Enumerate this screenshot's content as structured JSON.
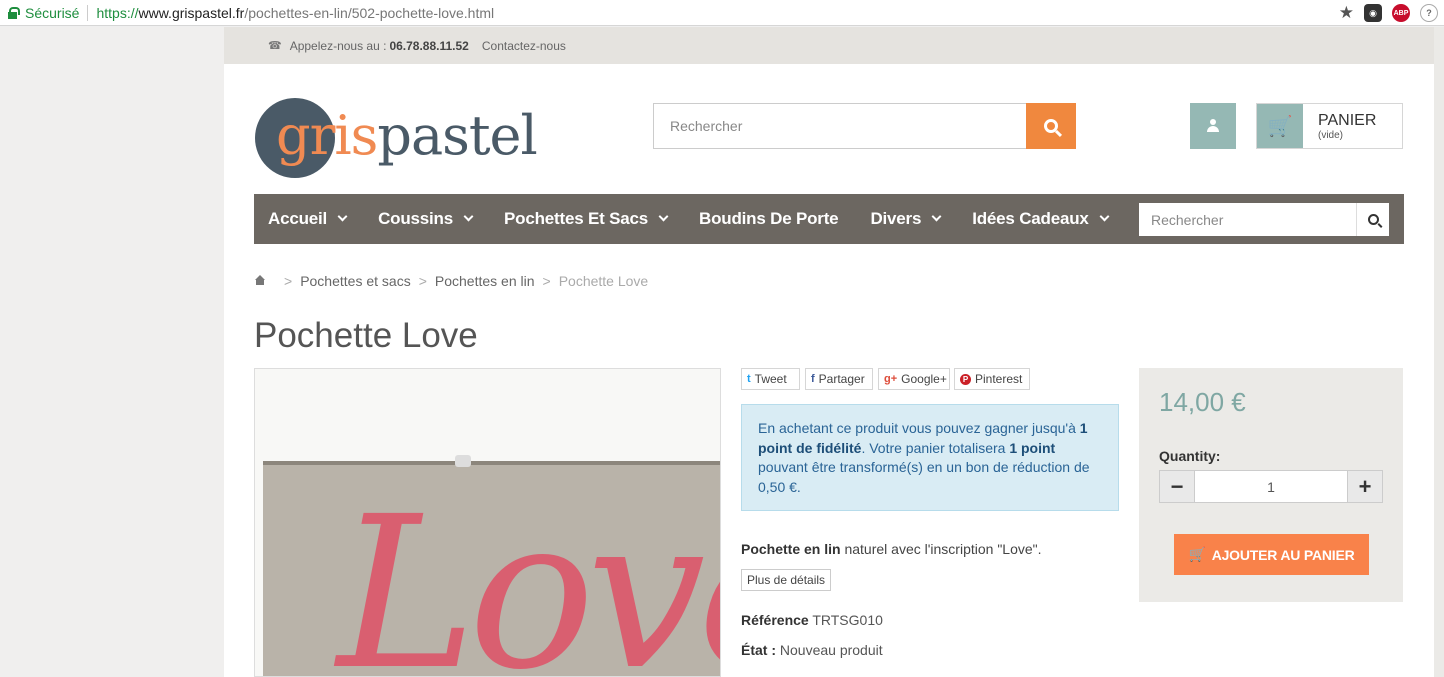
{
  "browser": {
    "secure_label": "Sécurisé",
    "url_scheme": "https://",
    "url_host": "www.grispastel.fr",
    "url_path": "/pochettes-en-lin/502-pochette-love.html",
    "star_icon": "★",
    "ext_abp": "ABP"
  },
  "topbar": {
    "phone_icon": "☎",
    "call_label": "Appelez-nous au :",
    "phone": "06.78.88.11.52",
    "contact": "Contactez-nous"
  },
  "logo": {
    "part1": "gris",
    "part2": "pastel"
  },
  "header": {
    "search_placeholder": "Rechercher",
    "cart_label": "PANIER",
    "cart_status": "(vide)",
    "cart_icon": "🛒"
  },
  "nav": {
    "items": [
      {
        "label": "Accueil",
        "dropdown": true
      },
      {
        "label": "Coussins",
        "dropdown": true
      },
      {
        "label": "Pochettes Et Sacs",
        "dropdown": true
      },
      {
        "label": "Boudins De Porte",
        "dropdown": false
      },
      {
        "label": "Divers",
        "dropdown": true
      },
      {
        "label": "Idées Cadeaux",
        "dropdown": true
      }
    ],
    "search_placeholder": "Rechercher"
  },
  "breadcrumb": {
    "sep": ">",
    "items": [
      "Pochettes et sacs",
      "Pochettes en lin"
    ],
    "current": "Pochette Love"
  },
  "product": {
    "title": "Pochette Love",
    "image_text": "Love",
    "share": {
      "tweet": "Tweet",
      "share": "Partager",
      "google": "Google+",
      "pinterest": "Pinterest",
      "tw_icon": "t",
      "fb_icon": "f",
      "gp_icon": "g+",
      "pin_icon": "P"
    },
    "loyalty": {
      "t1": "En achetant ce produit vous pouvez gagner jusqu'à ",
      "b1": "1 point de fidélité",
      "t2": ". Votre panier totalisera ",
      "b2": "1 point",
      "t3": " pouvant être transformé(s) en un bon de réduction de 0,50 €."
    },
    "desc_bold": "Pochette en lin",
    "desc_rest": " naturel avec l'inscription \"Love\".",
    "more_details": "Plus de détails",
    "reference_label": "Référence",
    "reference": "TRTSG010",
    "state_label": "État :",
    "state": "Nouveau produit"
  },
  "buy": {
    "price": "14,00 €",
    "quantity_label": "Quantity:",
    "minus": "−",
    "plus": "+",
    "quantity": "1",
    "add_to_cart": "AJOUTER AU PANIER",
    "cart_icon": "🛒"
  },
  "colors": {
    "accent_orange": "#f0883e",
    "button_orange": "#f9824a",
    "teal": "#95b8b4",
    "nav_bg": "#6c6761",
    "price": "#7fa7a3"
  }
}
